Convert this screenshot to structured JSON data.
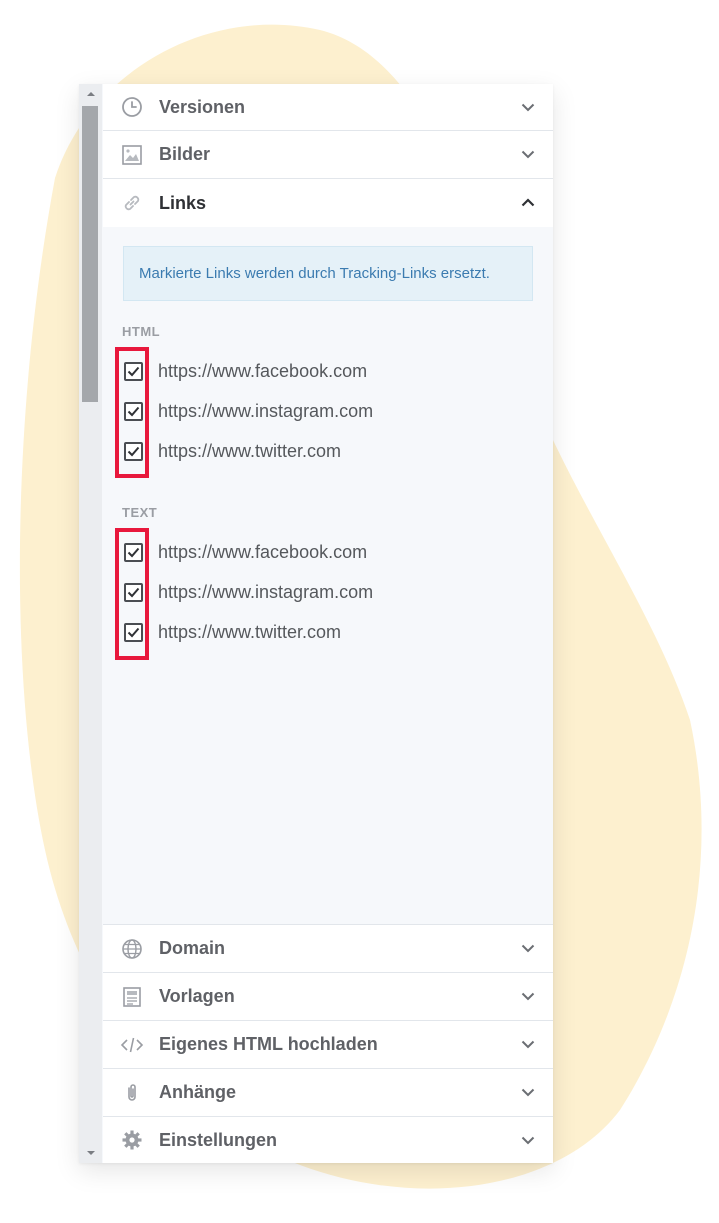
{
  "accordion": {
    "versions": {
      "label": "Versionen",
      "icon": "clock-icon"
    },
    "images": {
      "label": "Bilder",
      "icon": "image-icon"
    },
    "links": {
      "label": "Links",
      "icon": "link-icon"
    },
    "domain": {
      "label": "Domain",
      "icon": "globe-icon"
    },
    "templates": {
      "label": "Vorlagen",
      "icon": "document-icon"
    },
    "custom_html": {
      "label": "Eigenes HTML hochladen",
      "icon": "code-icon"
    },
    "attachments": {
      "label": "Anhänge",
      "icon": "paperclip-icon"
    },
    "settings": {
      "label": "Einstellungen",
      "icon": "gear-icon"
    }
  },
  "links_panel": {
    "info": "Markierte Links werden durch Tracking-Links ersetzt.",
    "html": {
      "label": "HTML",
      "items": [
        {
          "url": "https://www.facebook.com",
          "checked": true
        },
        {
          "url": "https://www.instagram.com",
          "checked": true
        },
        {
          "url": "https://www.twitter.com",
          "checked": true
        }
      ]
    },
    "text": {
      "label": "TEXT",
      "items": [
        {
          "url": "https://www.facebook.com",
          "checked": true
        },
        {
          "url": "https://www.instagram.com",
          "checked": true
        },
        {
          "url": "https://www.twitter.com",
          "checked": true
        }
      ]
    }
  },
  "colors": {
    "blob": "#fdf0cf",
    "highlight": "#e8183c",
    "info_bg": "#e5f1f8",
    "info_text": "#3b7bb0"
  }
}
